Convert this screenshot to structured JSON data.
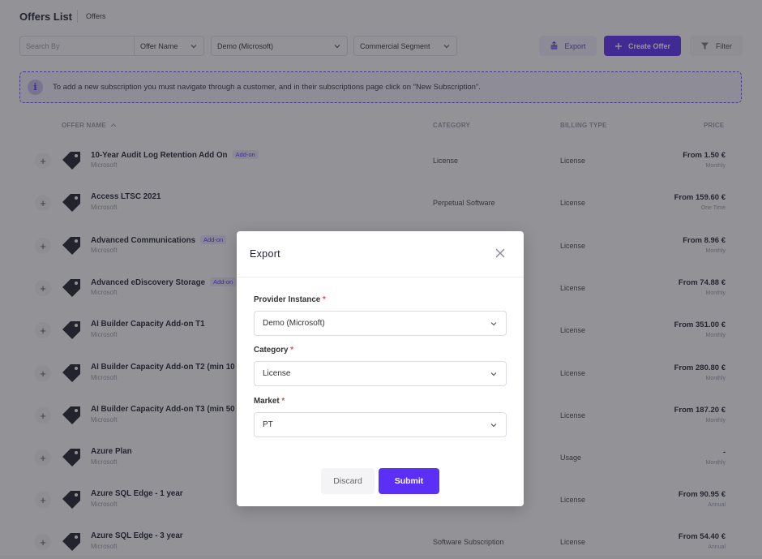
{
  "header": {
    "title": "Offers List",
    "breadcrumb": "Offers"
  },
  "toolbar": {
    "search_placeholder": "Search By",
    "search_field": "Offer Name",
    "provider": "Demo (Microsoft)",
    "segment": "Commercial Segment",
    "export_label": "Export",
    "create_label": "Create Offer",
    "filter_label": "Filter"
  },
  "banner": {
    "text": "To add a new subscription you must navigate through a customer, and in their subscriptions page click on \"New Subscription\"."
  },
  "table": {
    "columns": {
      "name": "OFFER NAME",
      "category": "CATEGORY",
      "billing": "BILLING TYPE",
      "price": "PRICE"
    },
    "addon_label": "Add-on",
    "rows": [
      {
        "name": "10-Year Audit Log Retention Add On",
        "addon": true,
        "vendor": "Microsoft",
        "category": "License",
        "billing": "License",
        "price": "From 1.50 €",
        "period": "Monthly"
      },
      {
        "name": "Access LTSC 2021",
        "addon": false,
        "vendor": "Microsoft",
        "category": "Perpetual Software",
        "billing": "License",
        "price": "From 159.60 €",
        "period": "One Time"
      },
      {
        "name": "Advanced Communications",
        "addon": true,
        "vendor": "Microsoft",
        "category": "",
        "billing": "License",
        "price": "From 8.96 €",
        "period": "Monthly"
      },
      {
        "name": "Advanced eDiscovery Storage",
        "addon": true,
        "vendor": "Microsoft",
        "category": "",
        "billing": "License",
        "price": "From 74.88 €",
        "period": "Monthly"
      },
      {
        "name": "AI Builder Capacity Add-on T1",
        "addon": false,
        "vendor": "Microsoft",
        "category": "",
        "billing": "License",
        "price": "From 351.00 €",
        "period": "Monthly"
      },
      {
        "name": "AI Builder Capacity Add-on T2 (min 10",
        "addon": false,
        "vendor": "Microsoft",
        "category": "",
        "billing": "License",
        "price": "From 280.80 €",
        "period": "Monthly"
      },
      {
        "name": "AI Builder Capacity Add-on T3 (min 50",
        "addon": false,
        "vendor": "Microsoft",
        "category": "",
        "billing": "License",
        "price": "From 187.20 €",
        "period": "Monthly"
      },
      {
        "name": "Azure Plan",
        "addon": false,
        "vendor": "Microsoft",
        "category": "",
        "billing": "Usage",
        "price": "-",
        "period": "Monthly"
      },
      {
        "name": "Azure SQL Edge - 1 year",
        "addon": false,
        "vendor": "Microsoft",
        "category": "",
        "billing": "License",
        "price": "From 90.95 €",
        "period": "Annual"
      },
      {
        "name": "Azure SQL Edge - 3 year",
        "addon": false,
        "vendor": "Microsoft",
        "category": "Software Subscription",
        "billing": "License",
        "price": "From 54.40 €",
        "period": "Annual"
      }
    ]
  },
  "modal": {
    "title": "Export",
    "provider_label": "Provider Instance",
    "provider_value": "Demo (Microsoft)",
    "category_label": "Category",
    "category_value": "License",
    "market_label": "Market",
    "market_value": "PT",
    "required_mark": "*",
    "discard_label": "Discard",
    "submit_label": "Submit"
  },
  "colors": {
    "accent": "#5b2ff5",
    "overlay": "rgba(40,40,48,0.5)",
    "required": "#e5484d"
  },
  "icons": {
    "close": "close-icon",
    "chevron": "chevron-down-icon",
    "tag": "tag-icon",
    "export": "export-icon",
    "plus": "plus-icon",
    "filter": "filter-icon",
    "info": "info-icon"
  }
}
